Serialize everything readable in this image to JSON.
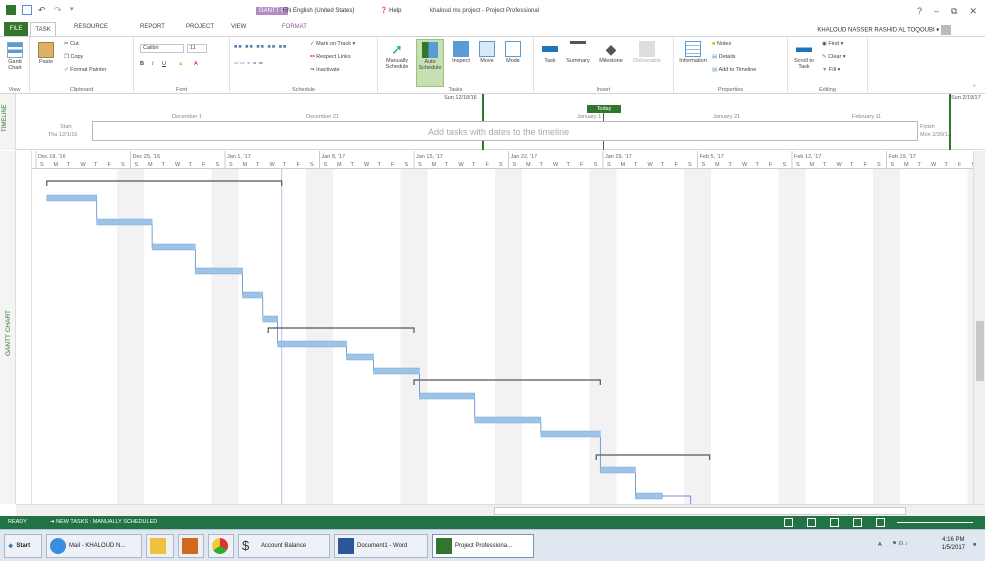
{
  "window": {
    "context_tab": "GANTT C",
    "language": "EN English (United States)",
    "help": "Help",
    "title": "khaloud ms project - Project Professional",
    "user": "KHALOUD NASSER RASHID AL TOQOUBI"
  },
  "tabs": [
    "FILE",
    "TASK",
    "RESOURCE",
    "REPORT",
    "PROJECT",
    "VIEW",
    "FORMAT"
  ],
  "ribbon": {
    "view": {
      "btn": "Gantt Chart",
      "label": "View"
    },
    "clipboard": {
      "paste": "Paste",
      "cut": "Cut",
      "copy": "Copy",
      "format_painter": "Format Painter",
      "label": "Clipboard"
    },
    "font": {
      "name": "Calibri",
      "size": "11",
      "label": "Font"
    },
    "schedule": {
      "mark_on_track": "Mark on Track",
      "respect_links": "Respect Links",
      "inactivate": "Inactivate",
      "label": "Schedule"
    },
    "tasks": {
      "manually": "Manually Schedule",
      "auto": "Auto Schedule",
      "inspect": "Inspect",
      "move": "Move",
      "mode": "Mode",
      "label": "Tasks"
    },
    "insert": {
      "task": "Task",
      "summary": "Summary",
      "milestone": "Milestone",
      "deliverable": "Deliverable",
      "label": "Insert"
    },
    "properties": {
      "information": "Information",
      "notes": "Notes",
      "details": "Details",
      "add_timeline": "Add to Timeline",
      "label": "Properties"
    },
    "editing": {
      "scroll": "Scroll to Task",
      "find": "Find",
      "clear": "Clear",
      "fill": "Fill",
      "label": "Editing"
    }
  },
  "timeline": {
    "label": "TIMELINE",
    "start_word": "Start",
    "start_date": "Thu 12/1/16",
    "finish_word": "Finish",
    "finish_date": "Mon 2/20/17",
    "placeholder": "Add tasks with dates to the timeline",
    "today": "Today",
    "range_left": "Sun 12/18/16",
    "range_right": "Sun 2/19/17",
    "ticks": [
      "December 1",
      "December 21",
      "January 1",
      "January 21",
      "February 11"
    ]
  },
  "gantt": {
    "label": "GANTT CHART",
    "weeks": [
      "Dec 18, '16",
      "Dec 25, '16",
      "Jan 1, '17",
      "Jan 8, '17",
      "Jan 15, '17",
      "Jan 22, '17",
      "Jan 29, '17",
      "Feb 5, '17",
      "Feb 12, '17",
      "Feb 19, '17"
    ],
    "days": [
      "S",
      "M",
      "T",
      "W",
      "T",
      "F",
      "S"
    ]
  },
  "status": {
    "ready": "READY",
    "new_tasks": "NEW TASKS : MANUALLY SCHEDULED"
  },
  "taskbar": {
    "start": "Start",
    "items": [
      "Mail - KHALOUD N...",
      "Account Balance",
      "Document1 - Word",
      "Project Professiona..."
    ],
    "lang": "A",
    "time": "4:16 PM",
    "date": "1/5/2017"
  }
}
